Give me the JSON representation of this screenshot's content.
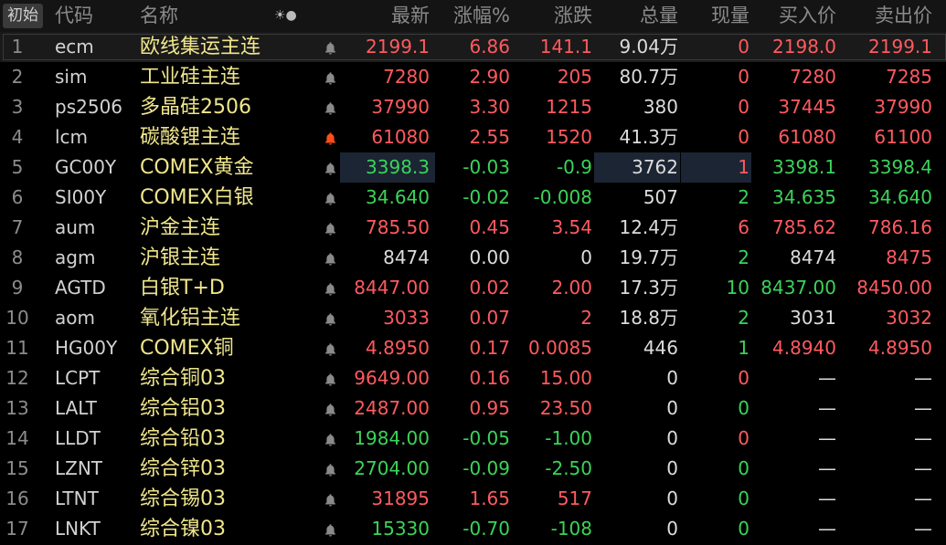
{
  "header": {
    "tag": "初始",
    "code": "代码",
    "name": "名称",
    "controls": "☀●",
    "last": "最新",
    "pct": "涨幅%",
    "change": "涨跌",
    "volume": "总量",
    "current": "现量",
    "bid": "买入价",
    "ask": "卖出价"
  },
  "colors": {
    "up": "#ff5a5f",
    "down": "#3bd35a",
    "flat": "#dcdcdc",
    "name": "#f0e68c",
    "bell_active": "#ff4e1a"
  },
  "rows": [
    {
      "num": "1",
      "code": "ecm",
      "name": "欧线集运主连",
      "last": "2199.1",
      "pct": "6.86",
      "chg": "141.1",
      "vol": "9.04万",
      "cur": "0",
      "bid": "2198.0",
      "ask": "2199.1",
      "c_last": "up",
      "c_pct": "up",
      "c_chg": "up",
      "c_cur": "up",
      "c_bid": "up",
      "c_ask": "up",
      "bell": "normal"
    },
    {
      "num": "2",
      "code": "sim",
      "name": "工业硅主连",
      "last": "7280",
      "pct": "2.90",
      "chg": "205",
      "vol": "80.7万",
      "cur": "0",
      "bid": "7280",
      "ask": "7285",
      "c_last": "up",
      "c_pct": "up",
      "c_chg": "up",
      "c_cur": "up",
      "c_bid": "up",
      "c_ask": "up",
      "bell": "normal"
    },
    {
      "num": "3",
      "code": "ps2506",
      "name": "多晶硅2506",
      "last": "37990",
      "pct": "3.30",
      "chg": "1215",
      "vol": "380",
      "cur": "0",
      "bid": "37445",
      "ask": "37990",
      "c_last": "up",
      "c_pct": "up",
      "c_chg": "up",
      "c_cur": "up",
      "c_bid": "up",
      "c_ask": "up",
      "bell": "normal"
    },
    {
      "num": "4",
      "code": "lcm",
      "name": "碳酸锂主连",
      "last": "61080",
      "pct": "2.55",
      "chg": "1520",
      "vol": "41.3万",
      "cur": "0",
      "bid": "61080",
      "ask": "61100",
      "c_last": "up",
      "c_pct": "up",
      "c_chg": "up",
      "c_cur": "up",
      "c_bid": "up",
      "c_ask": "up",
      "bell": "active"
    },
    {
      "num": "5",
      "code": "GC00Y",
      "name": "COMEX黄金",
      "last": "3398.3",
      "pct": "-0.03",
      "chg": "-0.9",
      "vol": "3762",
      "cur": "1",
      "bid": "3398.1",
      "ask": "3398.4",
      "c_last": "dn",
      "c_pct": "dn",
      "c_chg": "dn",
      "c_cur": "up",
      "c_bid": "dn",
      "c_ask": "dn",
      "bell": "normal",
      "highlight": true
    },
    {
      "num": "6",
      "code": "SI00Y",
      "name": "COMEX白银",
      "last": "34.640",
      "pct": "-0.02",
      "chg": "-0.008",
      "vol": "507",
      "cur": "2",
      "bid": "34.635",
      "ask": "34.640",
      "c_last": "dn",
      "c_pct": "dn",
      "c_chg": "dn",
      "c_cur": "dn",
      "c_bid": "dn",
      "c_ask": "dn",
      "bell": "normal"
    },
    {
      "num": "7",
      "code": "aum",
      "name": "沪金主连",
      "last": "785.50",
      "pct": "0.45",
      "chg": "3.54",
      "vol": "12.4万",
      "cur": "6",
      "bid": "785.62",
      "ask": "786.16",
      "c_last": "up",
      "c_pct": "up",
      "c_chg": "up",
      "c_cur": "up",
      "c_bid": "up",
      "c_ask": "up",
      "bell": "normal"
    },
    {
      "num": "8",
      "code": "agm",
      "name": "沪银主连",
      "last": "8474",
      "pct": "0.00",
      "chg": "0",
      "vol": "19.7万",
      "cur": "2",
      "bid": "8474",
      "ask": "8475",
      "c_last": "fl",
      "c_pct": "fl",
      "c_chg": "fl",
      "c_cur": "dn",
      "c_bid": "fl",
      "c_ask": "up",
      "bell": "normal"
    },
    {
      "num": "9",
      "code": "AGTD",
      "name": "白银T+D",
      "last": "8447.00",
      "pct": "0.02",
      "chg": "2.00",
      "vol": "17.3万",
      "cur": "10",
      "bid": "8437.00",
      "ask": "8450.00",
      "c_last": "up",
      "c_pct": "up",
      "c_chg": "up",
      "c_cur": "dn",
      "c_bid": "dn",
      "c_ask": "up",
      "bell": "normal"
    },
    {
      "num": "10",
      "code": "aom",
      "name": "氧化铝主连",
      "last": "3033",
      "pct": "0.07",
      "chg": "2",
      "vol": "18.8万",
      "cur": "2",
      "bid": "3031",
      "ask": "3032",
      "c_last": "up",
      "c_pct": "up",
      "c_chg": "up",
      "c_cur": "dn",
      "c_bid": "fl",
      "c_ask": "up",
      "bell": "normal"
    },
    {
      "num": "11",
      "code": "HG00Y",
      "name": "COMEX铜",
      "last": "4.8950",
      "pct": "0.17",
      "chg": "0.0085",
      "vol": "446",
      "cur": "1",
      "bid": "4.8940",
      "ask": "4.8950",
      "c_last": "up",
      "c_pct": "up",
      "c_chg": "up",
      "c_cur": "dn",
      "c_bid": "up",
      "c_ask": "up",
      "bell": "normal"
    },
    {
      "num": "12",
      "code": "LCPT",
      "name": "综合铜03",
      "last": "9649.00",
      "pct": "0.16",
      "chg": "15.00",
      "vol": "0",
      "cur": "0",
      "bid": "—",
      "ask": "—",
      "c_last": "up",
      "c_pct": "up",
      "c_chg": "up",
      "c_cur": "up",
      "c_bid": "fl",
      "c_ask": "fl",
      "bell": "normal"
    },
    {
      "num": "13",
      "code": "LALT",
      "name": "综合铝03",
      "last": "2487.00",
      "pct": "0.95",
      "chg": "23.50",
      "vol": "0",
      "cur": "0",
      "bid": "—",
      "ask": "—",
      "c_last": "up",
      "c_pct": "up",
      "c_chg": "up",
      "c_cur": "dn",
      "c_bid": "fl",
      "c_ask": "fl",
      "bell": "normal"
    },
    {
      "num": "14",
      "code": "LLDT",
      "name": "综合铅03",
      "last": "1984.00",
      "pct": "-0.05",
      "chg": "-1.00",
      "vol": "0",
      "cur": "0",
      "bid": "—",
      "ask": "—",
      "c_last": "dn",
      "c_pct": "dn",
      "c_chg": "dn",
      "c_cur": "up",
      "c_bid": "fl",
      "c_ask": "fl",
      "bell": "normal"
    },
    {
      "num": "15",
      "code": "LZNT",
      "name": "综合锌03",
      "last": "2704.00",
      "pct": "-0.09",
      "chg": "-2.50",
      "vol": "0",
      "cur": "0",
      "bid": "—",
      "ask": "—",
      "c_last": "dn",
      "c_pct": "dn",
      "c_chg": "dn",
      "c_cur": "dn",
      "c_bid": "fl",
      "c_ask": "fl",
      "bell": "normal"
    },
    {
      "num": "16",
      "code": "LTNT",
      "name": "综合锡03",
      "last": "31895",
      "pct": "1.65",
      "chg": "517",
      "vol": "0",
      "cur": "0",
      "bid": "—",
      "ask": "—",
      "c_last": "up",
      "c_pct": "up",
      "c_chg": "up",
      "c_cur": "dn",
      "c_bid": "fl",
      "c_ask": "fl",
      "bell": "normal"
    },
    {
      "num": "17",
      "code": "LNKT",
      "name": "综合镍03",
      "last": "15330",
      "pct": "-0.70",
      "chg": "-108",
      "vol": "0",
      "cur": "0",
      "bid": "—",
      "ask": "—",
      "c_last": "dn",
      "c_pct": "dn",
      "c_chg": "dn",
      "c_cur": "dn",
      "c_bid": "fl",
      "c_ask": "fl",
      "bell": "normal"
    }
  ]
}
